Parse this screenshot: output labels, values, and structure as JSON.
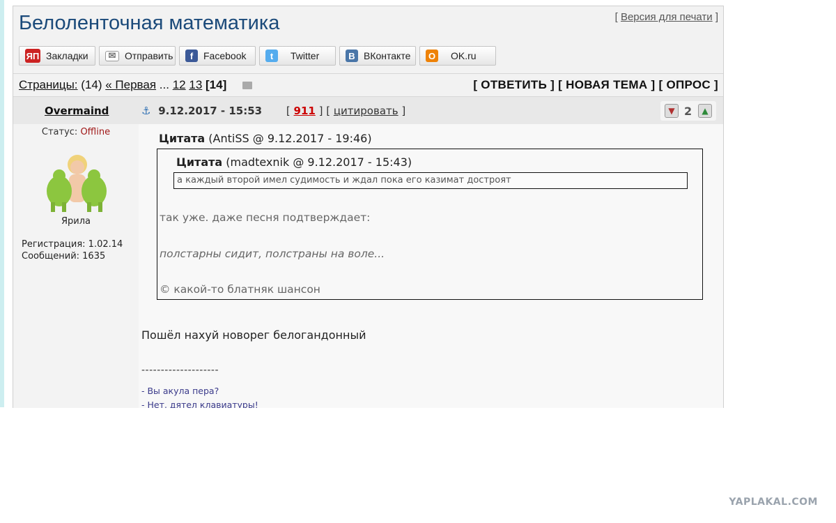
{
  "topic": {
    "title": "Белоленточная математика",
    "print_open": "[ ",
    "print_link": "Версия для печати",
    "print_close": " ]"
  },
  "share": [
    {
      "icon": "yandex-bookmarks-icon",
      "icon_text": "ЯП",
      "label": "Закладки",
      "color": "#cc2222"
    },
    {
      "icon": "mail-icon",
      "icon_text": "✉",
      "label": "Отправить",
      "color": "#888888"
    },
    {
      "icon": "facebook-icon",
      "icon_text": "f",
      "label": "Facebook",
      "color": "#3b5998"
    },
    {
      "icon": "twitter-icon",
      "icon_text": "t",
      "label": "Twitter",
      "color": "#55acee"
    },
    {
      "icon": "vkontakte-icon",
      "icon_text": "В",
      "label": "ВКонтакте",
      "color": "#4a76a8"
    },
    {
      "icon": "odnoklassniki-icon",
      "icon_text": "О",
      "label": "OK.ru",
      "color": "#ee8208"
    }
  ],
  "pagination": {
    "label": "Страницы:",
    "count": "(14)",
    "first": "« Первая",
    "ellipsis": "...",
    "p12": "12",
    "p13": "13",
    "current": "[14]"
  },
  "actions": {
    "reply": "[ ОТВЕТИТЬ ]",
    "new_topic": "[ НОВАЯ ТЕМА ]",
    "poll": "[ ОПРОС ]"
  },
  "post": {
    "author": "Overmaind",
    "anchor": "⚓",
    "date": "9.12.2017 - 15:53",
    "number_open": "[ ",
    "number": "911",
    "number_close": " ] [ ",
    "cite": "цитировать",
    "cite_close": " ]",
    "rating": "2"
  },
  "author": {
    "status_label": "Статус:",
    "status_value": "Offline",
    "name": "Ярила",
    "registration": "Регистрация: 1.02.14",
    "messages": "Сообщений: 1635"
  },
  "content": {
    "quote1_label": "Цитата",
    "quote1_source": "(AntiSS @ 9.12.2017 - 19:46)",
    "quote2_label": "Цитата",
    "quote2_source": "(madtexnik @ 9.12.2017 - 15:43)",
    "quote2_text": "а каждый второй имел судимость и ждал пока его казимат достроят",
    "q1_line1": "так уже. даже песня подтверждает:",
    "q1_line2": "полстарны сидит, полстраны на воле...",
    "q1_line3": "© какой-то блатняк шансон",
    "text": "Пошёл нахуй новорег белогандонный",
    "sig_divider": "--------------------",
    "sig1": "- Вы акула пера?",
    "sig2": "- Нет, дятел клавиатуры!"
  },
  "watermark": "YAPLAKAL.COM"
}
